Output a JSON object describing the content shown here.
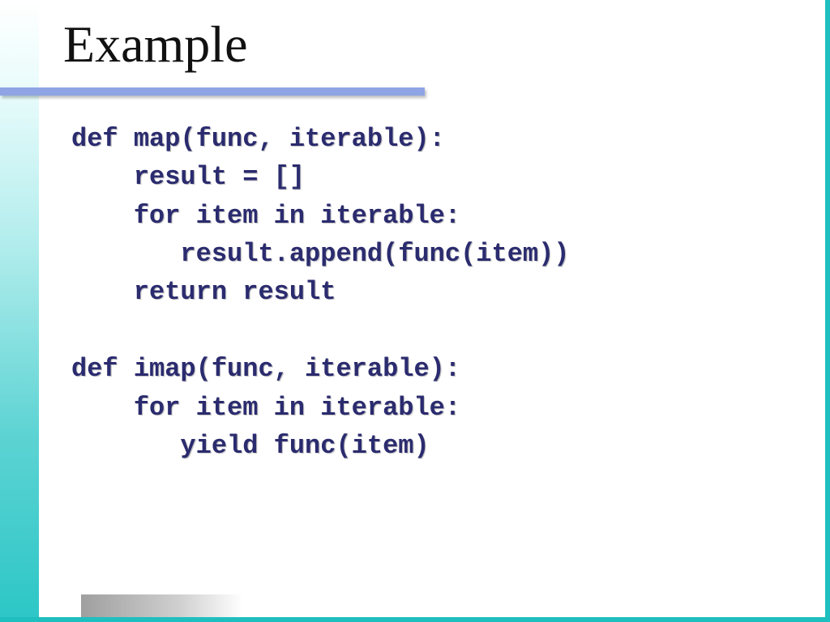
{
  "title": "Example",
  "code": "def map(func, iterable):\n    result = []\n    for item in iterable:\n       result.append(func(item))\n    return result\n\ndef imap(func, iterable):\n    for item in iterable:\n       yield func(item)"
}
